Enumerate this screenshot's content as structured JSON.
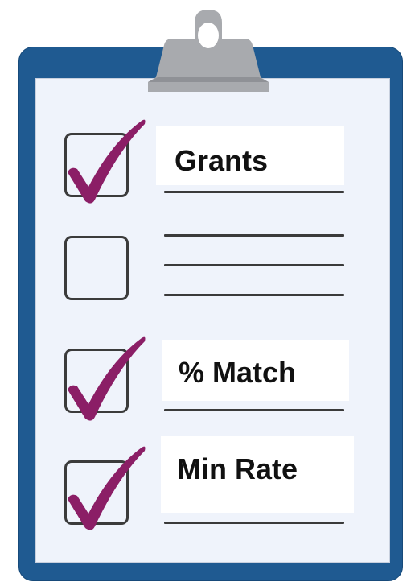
{
  "colors": {
    "board": "#1f5a91",
    "paper": "#eff3fb",
    "clip": "#a8aaae",
    "checkmark": "#8b1e66",
    "box_border": "#3b3b3b",
    "line": "#3a3a3a"
  },
  "checklist": {
    "items": [
      {
        "label": "Grants",
        "checked": true
      },
      {
        "label": "",
        "checked": false
      },
      {
        "label": "% Match",
        "checked": true
      },
      {
        "label": "Min Rate",
        "checked": true
      }
    ]
  }
}
